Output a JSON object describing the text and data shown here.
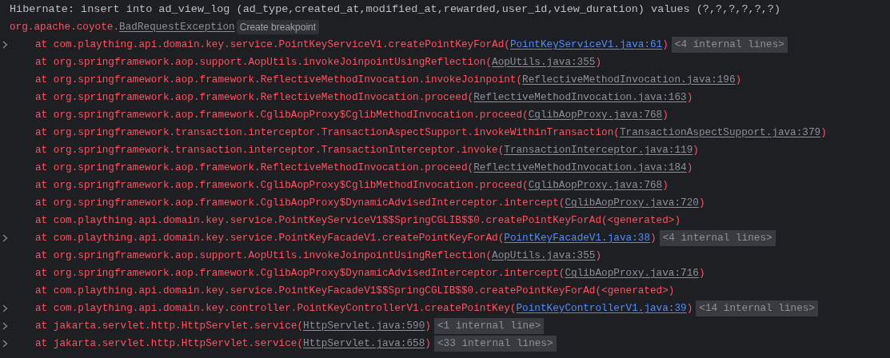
{
  "log_line": "Hibernate: insert into ad_view_log (ad_type,created_at,modified_at,rewarded,user_id,view_duration) values (?,?,?,?,?,?)",
  "exception": {
    "package": "org.apache.coyote.",
    "class_name": "BadRequestException",
    "action": "Create breakpoint"
  },
  "frames": [
    {
      "expandable": true,
      "text": "at com.plaything.api.domain.key.service.PointKeyServiceV1.createPointKeyForAd(",
      "source": {
        "text": "PointKeyServiceV1.java:61",
        "kind": "project"
      },
      "tail": ")",
      "folded": "<4 internal lines>"
    },
    {
      "expandable": false,
      "text": "at org.springframework.aop.support.AopUtils.invokeJoinpointUsingReflection(",
      "source": {
        "text": "AopUtils.java:355",
        "kind": "library"
      },
      "tail": ")"
    },
    {
      "expandable": false,
      "text": "at org.springframework.aop.framework.ReflectiveMethodInvocation.invokeJoinpoint(",
      "source": {
        "text": "ReflectiveMethodInvocation.java:196",
        "kind": "library"
      },
      "tail": ")"
    },
    {
      "expandable": false,
      "text": "at org.springframework.aop.framework.ReflectiveMethodInvocation.proceed(",
      "source": {
        "text": "ReflectiveMethodInvocation.java:163",
        "kind": "library"
      },
      "tail": ")"
    },
    {
      "expandable": false,
      "text": "at org.springframework.aop.framework.CglibAopProxy$CglibMethodInvocation.proceed(",
      "source": {
        "text": "CglibAopProxy.java:768",
        "kind": "library"
      },
      "tail": ")"
    },
    {
      "expandable": false,
      "text": "at org.springframework.transaction.interceptor.TransactionAspectSupport.invokeWithinTransaction(",
      "source": {
        "text": "TransactionAspectSupport.java:379",
        "kind": "library"
      },
      "tail": ")"
    },
    {
      "expandable": false,
      "text": "at org.springframework.transaction.interceptor.TransactionInterceptor.invoke(",
      "source": {
        "text": "TransactionInterceptor.java:119",
        "kind": "library"
      },
      "tail": ")"
    },
    {
      "expandable": false,
      "text": "at org.springframework.aop.framework.ReflectiveMethodInvocation.proceed(",
      "source": {
        "text": "ReflectiveMethodInvocation.java:184",
        "kind": "library"
      },
      "tail": ")"
    },
    {
      "expandable": false,
      "text": "at org.springframework.aop.framework.CglibAopProxy$CglibMethodInvocation.proceed(",
      "source": {
        "text": "CglibAopProxy.java:768",
        "kind": "library"
      },
      "tail": ")"
    },
    {
      "expandable": false,
      "text": "at org.springframework.aop.framework.CglibAopProxy$DynamicAdvisedInterceptor.intercept(",
      "source": {
        "text": "CglibAopProxy.java:720",
        "kind": "library"
      },
      "tail": ")"
    },
    {
      "expandable": false,
      "text": "at com.plaything.api.domain.key.service.PointKeyServiceV1$$SpringCGLIB$$0.createPointKeyForAd(<generated>)"
    },
    {
      "expandable": true,
      "text": "at com.plaything.api.domain.key.service.PointKeyFacadeV1.createPointKeyForAd(",
      "source": {
        "text": "PointKeyFacadeV1.java:38",
        "kind": "project"
      },
      "tail": ")",
      "folded": "<4 internal lines>"
    },
    {
      "expandable": false,
      "text": "at org.springframework.aop.support.AopUtils.invokeJoinpointUsingReflection(",
      "source": {
        "text": "AopUtils.java:355",
        "kind": "library"
      },
      "tail": ")"
    },
    {
      "expandable": false,
      "text": "at org.springframework.aop.framework.CglibAopProxy$DynamicAdvisedInterceptor.intercept(",
      "source": {
        "text": "CglibAopProxy.java:716",
        "kind": "library"
      },
      "tail": ")"
    },
    {
      "expandable": false,
      "text": "at com.plaything.api.domain.key.service.PointKeyFacadeV1$$SpringCGLIB$$0.createPointKeyForAd(<generated>)"
    },
    {
      "expandable": true,
      "text": "at com.plaything.api.domain.key.controller.PointKeyControllerV1.createPointKey(",
      "source": {
        "text": "PointKeyControllerV1.java:39",
        "kind": "project"
      },
      "tail": ")",
      "folded": "<14 internal lines>"
    },
    {
      "expandable": true,
      "text": "at jakarta.servlet.http.HttpServlet.service(",
      "source": {
        "text": "HttpServlet.java:590",
        "kind": "library"
      },
      "tail": ")",
      "folded": "<1 internal line>"
    },
    {
      "expandable": true,
      "text": "at jakarta.servlet.http.HttpServlet.service(",
      "source": {
        "text": "HttpServlet.java:658",
        "kind": "library"
      },
      "tail": ")",
      "folded": "<33 internal lines>"
    }
  ]
}
